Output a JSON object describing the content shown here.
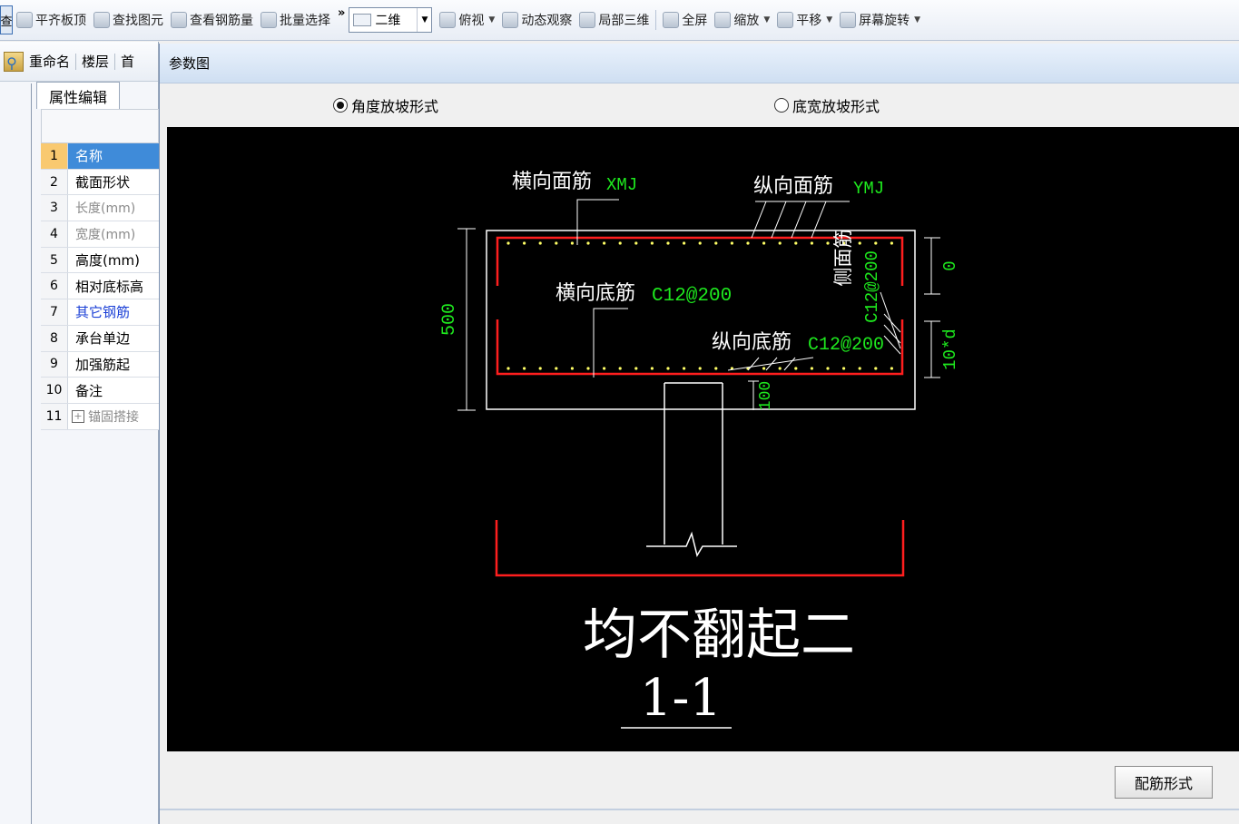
{
  "toolbar": {
    "left_btn": "查",
    "items": [
      "平齐板顶",
      "查找图元",
      "查看钢筋量",
      "批量选择"
    ],
    "more": "»",
    "view_combo": "二维",
    "view_items": [
      "俯视",
      "动态观察",
      "局部三维"
    ],
    "zoom_items": [
      "全屏",
      "缩放",
      "平移",
      "屏幕旋转"
    ]
  },
  "leftbar": {
    "rename": "重命名",
    "floor": "楼层",
    "first": "首",
    "tab": "属性编辑",
    "rows": [
      {
        "num": "1",
        "label": "名称"
      },
      {
        "num": "2",
        "label": "截面形状"
      },
      {
        "num": "3",
        "label": "长度(mm)"
      },
      {
        "num": "4",
        "label": "宽度(mm)"
      },
      {
        "num": "5",
        "label": "高度(mm)"
      },
      {
        "num": "6",
        "label": "相对底标高"
      },
      {
        "num": "7",
        "label": "其它钢筋"
      },
      {
        "num": "8",
        "label": "承台单边"
      },
      {
        "num": "9",
        "label": "加强筋起"
      },
      {
        "num": "10",
        "label": "备注"
      },
      {
        "num": "11",
        "label": "锚固搭接"
      }
    ]
  },
  "dialog": {
    "title": "参数图",
    "radio_angle": "角度放坡形式",
    "radio_width": "底宽放坡形式",
    "button_rebar": "配筋形式"
  },
  "drawing": {
    "top_cross_label": "横向面筋",
    "top_cross_code": "XMJ",
    "top_long_label": "纵向面筋",
    "top_long_code": "YMJ",
    "bot_cross_label": "横向底筋",
    "bot_cross_code": "C12@200",
    "bot_long_label": "纵向底筋",
    "bot_long_code": "C12@200",
    "side_label": "侧面筋",
    "side_code": "C12@200",
    "dim_height": "500",
    "dim_zero": "0",
    "dim_10d": "10*d",
    "dim_100": "100",
    "caption": "均不翻起二",
    "section": "1-1"
  },
  "colors": {
    "rebar_red": "#ff1e1e",
    "label_green": "#1ee81e",
    "line_white": "#ffffff",
    "dot_yellow": "#ffff66"
  }
}
